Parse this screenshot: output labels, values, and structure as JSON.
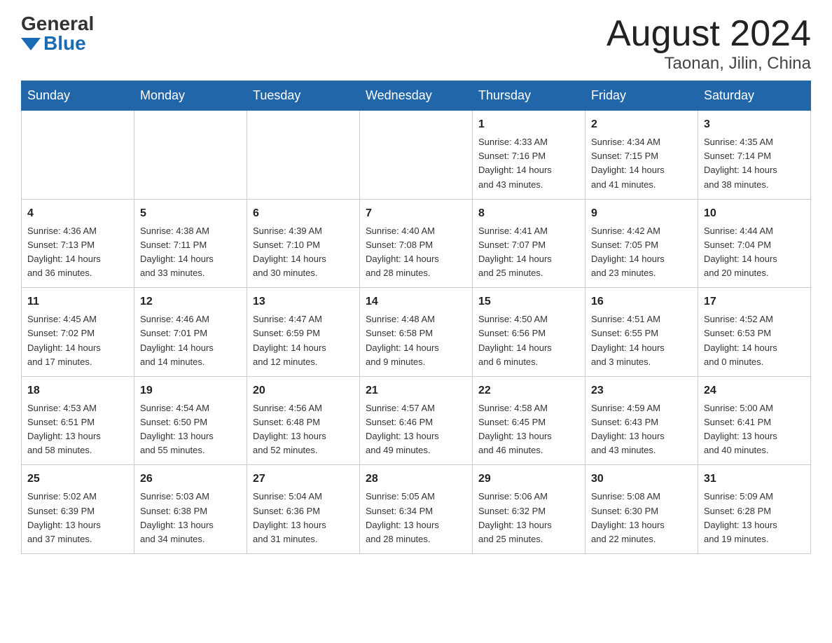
{
  "logo": {
    "general": "General",
    "blue": "Blue"
  },
  "title": {
    "month": "August 2024",
    "location": "Taonan, Jilin, China"
  },
  "weekdays": [
    "Sunday",
    "Monday",
    "Tuesday",
    "Wednesday",
    "Thursday",
    "Friday",
    "Saturday"
  ],
  "weeks": [
    [
      {
        "day": "",
        "info": ""
      },
      {
        "day": "",
        "info": ""
      },
      {
        "day": "",
        "info": ""
      },
      {
        "day": "",
        "info": ""
      },
      {
        "day": "1",
        "info": "Sunrise: 4:33 AM\nSunset: 7:16 PM\nDaylight: 14 hours\nand 43 minutes."
      },
      {
        "day": "2",
        "info": "Sunrise: 4:34 AM\nSunset: 7:15 PM\nDaylight: 14 hours\nand 41 minutes."
      },
      {
        "day": "3",
        "info": "Sunrise: 4:35 AM\nSunset: 7:14 PM\nDaylight: 14 hours\nand 38 minutes."
      }
    ],
    [
      {
        "day": "4",
        "info": "Sunrise: 4:36 AM\nSunset: 7:13 PM\nDaylight: 14 hours\nand 36 minutes."
      },
      {
        "day": "5",
        "info": "Sunrise: 4:38 AM\nSunset: 7:11 PM\nDaylight: 14 hours\nand 33 minutes."
      },
      {
        "day": "6",
        "info": "Sunrise: 4:39 AM\nSunset: 7:10 PM\nDaylight: 14 hours\nand 30 minutes."
      },
      {
        "day": "7",
        "info": "Sunrise: 4:40 AM\nSunset: 7:08 PM\nDaylight: 14 hours\nand 28 minutes."
      },
      {
        "day": "8",
        "info": "Sunrise: 4:41 AM\nSunset: 7:07 PM\nDaylight: 14 hours\nand 25 minutes."
      },
      {
        "day": "9",
        "info": "Sunrise: 4:42 AM\nSunset: 7:05 PM\nDaylight: 14 hours\nand 23 minutes."
      },
      {
        "day": "10",
        "info": "Sunrise: 4:44 AM\nSunset: 7:04 PM\nDaylight: 14 hours\nand 20 minutes."
      }
    ],
    [
      {
        "day": "11",
        "info": "Sunrise: 4:45 AM\nSunset: 7:02 PM\nDaylight: 14 hours\nand 17 minutes."
      },
      {
        "day": "12",
        "info": "Sunrise: 4:46 AM\nSunset: 7:01 PM\nDaylight: 14 hours\nand 14 minutes."
      },
      {
        "day": "13",
        "info": "Sunrise: 4:47 AM\nSunset: 6:59 PM\nDaylight: 14 hours\nand 12 minutes."
      },
      {
        "day": "14",
        "info": "Sunrise: 4:48 AM\nSunset: 6:58 PM\nDaylight: 14 hours\nand 9 minutes."
      },
      {
        "day": "15",
        "info": "Sunrise: 4:50 AM\nSunset: 6:56 PM\nDaylight: 14 hours\nand 6 minutes."
      },
      {
        "day": "16",
        "info": "Sunrise: 4:51 AM\nSunset: 6:55 PM\nDaylight: 14 hours\nand 3 minutes."
      },
      {
        "day": "17",
        "info": "Sunrise: 4:52 AM\nSunset: 6:53 PM\nDaylight: 14 hours\nand 0 minutes."
      }
    ],
    [
      {
        "day": "18",
        "info": "Sunrise: 4:53 AM\nSunset: 6:51 PM\nDaylight: 13 hours\nand 58 minutes."
      },
      {
        "day": "19",
        "info": "Sunrise: 4:54 AM\nSunset: 6:50 PM\nDaylight: 13 hours\nand 55 minutes."
      },
      {
        "day": "20",
        "info": "Sunrise: 4:56 AM\nSunset: 6:48 PM\nDaylight: 13 hours\nand 52 minutes."
      },
      {
        "day": "21",
        "info": "Sunrise: 4:57 AM\nSunset: 6:46 PM\nDaylight: 13 hours\nand 49 minutes."
      },
      {
        "day": "22",
        "info": "Sunrise: 4:58 AM\nSunset: 6:45 PM\nDaylight: 13 hours\nand 46 minutes."
      },
      {
        "day": "23",
        "info": "Sunrise: 4:59 AM\nSunset: 6:43 PM\nDaylight: 13 hours\nand 43 minutes."
      },
      {
        "day": "24",
        "info": "Sunrise: 5:00 AM\nSunset: 6:41 PM\nDaylight: 13 hours\nand 40 minutes."
      }
    ],
    [
      {
        "day": "25",
        "info": "Sunrise: 5:02 AM\nSunset: 6:39 PM\nDaylight: 13 hours\nand 37 minutes."
      },
      {
        "day": "26",
        "info": "Sunrise: 5:03 AM\nSunset: 6:38 PM\nDaylight: 13 hours\nand 34 minutes."
      },
      {
        "day": "27",
        "info": "Sunrise: 5:04 AM\nSunset: 6:36 PM\nDaylight: 13 hours\nand 31 minutes."
      },
      {
        "day": "28",
        "info": "Sunrise: 5:05 AM\nSunset: 6:34 PM\nDaylight: 13 hours\nand 28 minutes."
      },
      {
        "day": "29",
        "info": "Sunrise: 5:06 AM\nSunset: 6:32 PM\nDaylight: 13 hours\nand 25 minutes."
      },
      {
        "day": "30",
        "info": "Sunrise: 5:08 AM\nSunset: 6:30 PM\nDaylight: 13 hours\nand 22 minutes."
      },
      {
        "day": "31",
        "info": "Sunrise: 5:09 AM\nSunset: 6:28 PM\nDaylight: 13 hours\nand 19 minutes."
      }
    ]
  ]
}
